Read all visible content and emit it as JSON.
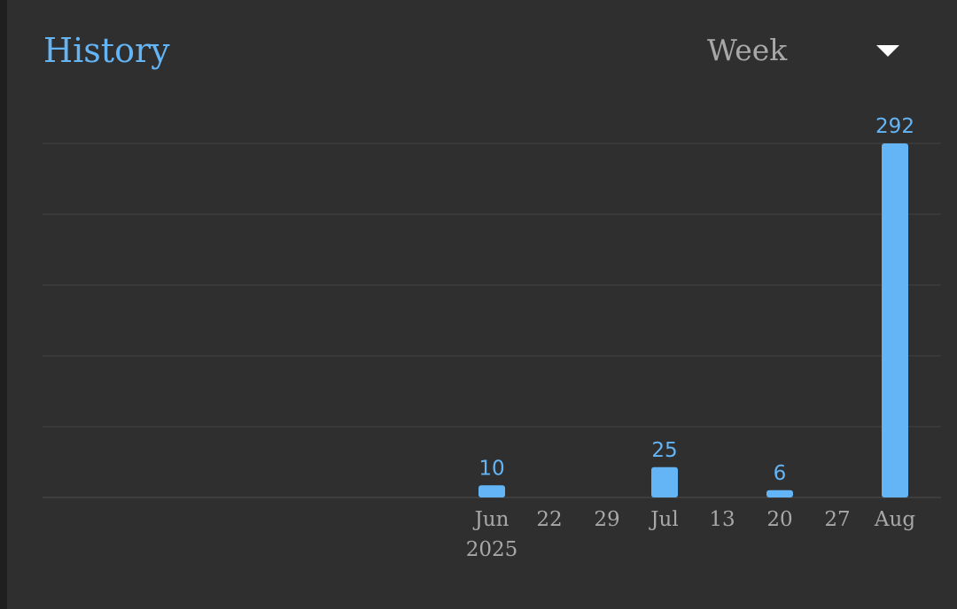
{
  "header": {
    "title": "History",
    "period": {
      "selected": "Week",
      "icon": "dropdown-arrow-icon"
    }
  },
  "colors": {
    "accent": "#64b5f6",
    "background": "#2f2f2f",
    "label": "#a8a8a8"
  },
  "chart_data": {
    "type": "bar",
    "title": "",
    "xlabel": "",
    "ylabel": "",
    "x_ticks": [
      {
        "label": "Jun",
        "sublabel": "2025"
      },
      {
        "label": "22",
        "sublabel": ""
      },
      {
        "label": "29",
        "sublabel": ""
      },
      {
        "label": "Jul",
        "sublabel": ""
      },
      {
        "label": "13",
        "sublabel": ""
      },
      {
        "label": "20",
        "sublabel": ""
      },
      {
        "label": "27",
        "sublabel": ""
      },
      {
        "label": "Aug",
        "sublabel": ""
      }
    ],
    "values": [
      10,
      0,
      0,
      25,
      0,
      6,
      0,
      292
    ],
    "ylim": [
      0,
      292
    ],
    "grid": true,
    "legend": "none"
  }
}
